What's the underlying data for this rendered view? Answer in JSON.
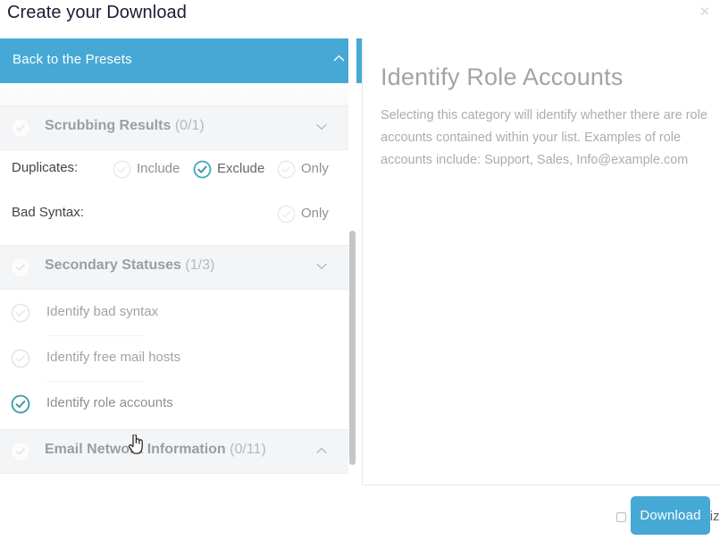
{
  "modal": {
    "title": "Create your Download",
    "close_icon": "close-icon"
  },
  "presets_bar": {
    "label": "Back to the Presets",
    "chevron_icon": "chevron-up-icon"
  },
  "sections": [
    {
      "title": "Scrubbing Results",
      "count": "(0/1)",
      "chevron_icon": "chevron-down-icon",
      "expanded": true
    },
    {
      "title": "Secondary Statuses",
      "count": "(1/3)",
      "chevron_icon": "chevron-down-icon",
      "expanded": true
    },
    {
      "title": "Email Network Information",
      "count": "(0/11)",
      "chevron_icon": "chevron-up-icon",
      "expanded": true
    }
  ],
  "option_rows": [
    {
      "label": "Duplicates:",
      "choices": [
        {
          "label": "Include",
          "selected": false
        },
        {
          "label": "Exclude",
          "selected": true
        },
        {
          "label": "Only",
          "selected": false
        }
      ]
    },
    {
      "label": "Bad Syntax:",
      "choices": [
        {
          "label": "Only",
          "selected": false
        }
      ]
    }
  ],
  "secondary_status_items": [
    {
      "label": "Identify bad syntax",
      "checked": false
    },
    {
      "label": "Identify free mail hosts",
      "checked": false
    },
    {
      "label": "Identify role accounts",
      "checked": true
    }
  ],
  "detail": {
    "title": "Identify Role Accounts",
    "description": "Selecting this category will identify whether there are role accounts contained within your list. Examples of role accounts include: Support, Sales, Info@example.com"
  },
  "footer": {
    "save_preset_label": "Save customized download as preset?",
    "save_preset_checked": false,
    "download_label": "Download"
  },
  "colors": {
    "accent_blue": "#46a8d5",
    "checked_teal": "#3fa9b5",
    "title_navy": "#1b1b38",
    "section_bg": "#f4f5f7",
    "muted_text": "#a0a4a9"
  }
}
